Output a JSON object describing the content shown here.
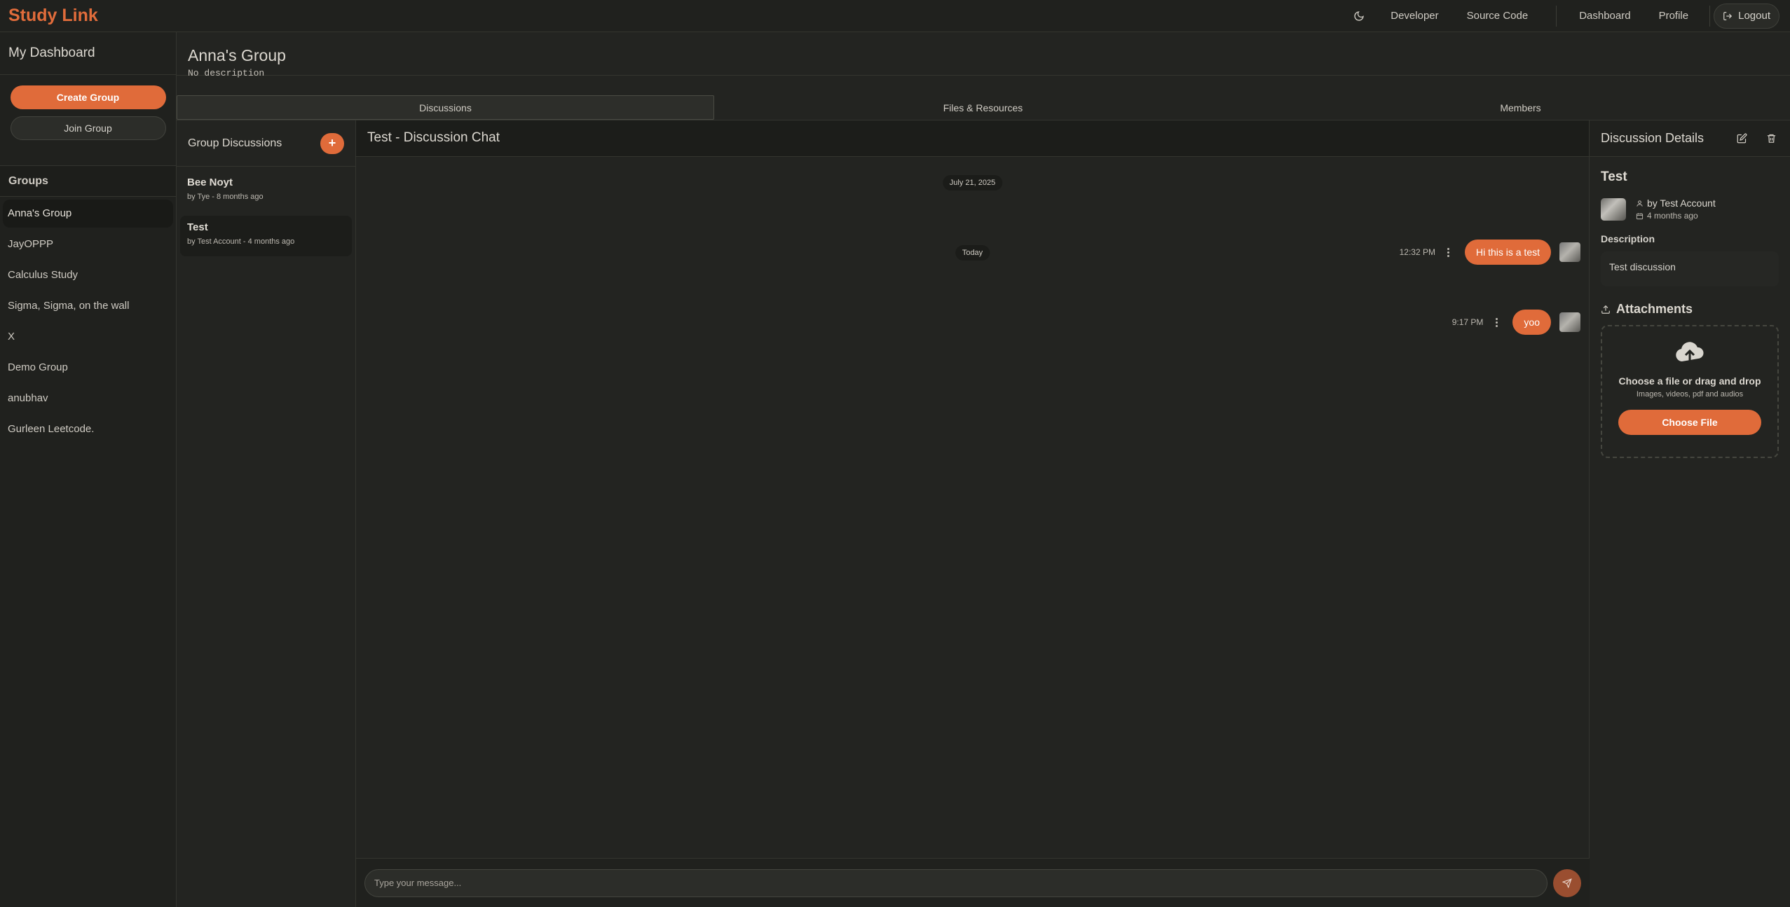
{
  "app": {
    "brand": "Study Link",
    "nav": {
      "developer": "Developer",
      "source_code": "Source Code",
      "dashboard": "Dashboard",
      "profile": "Profile",
      "logout": "Logout"
    }
  },
  "sidebar": {
    "title": "My Dashboard",
    "create_group": "Create Group",
    "join_group": "Join Group",
    "groups_heading": "Groups",
    "groups": [
      {
        "label": "Anna's Group",
        "active": true
      },
      {
        "label": "JayOPPP"
      },
      {
        "label": "Calculus Study"
      },
      {
        "label": "Sigma, Sigma, on the wall"
      },
      {
        "label": "X"
      },
      {
        "label": "Demo Group"
      },
      {
        "label": "anubhav"
      },
      {
        "label": "Gurleen Leetcode."
      }
    ]
  },
  "group": {
    "title": "Anna's Group",
    "description": "No description",
    "tabs": [
      "Discussions",
      "Files & Resources",
      "Members"
    ],
    "active_tab": "Discussions"
  },
  "discussions": {
    "heading": "Group Discussions",
    "add_label": "+",
    "items": [
      {
        "name": "Bee Noyt",
        "meta": "by Tye - 8 months ago"
      },
      {
        "name": "Test",
        "meta": "by Test Account - 4 months ago",
        "active": true
      }
    ]
  },
  "chat": {
    "title": "Test - Discussion Chat",
    "groups": [
      {
        "date": "July 21, 2025",
        "messages": [
          {
            "time": "12:32 PM",
            "text": "Hi this is a test"
          }
        ]
      },
      {
        "date": "Today",
        "messages": [
          {
            "time": "9:17 PM",
            "text": "yoo"
          }
        ]
      }
    ],
    "input_placeholder": "Type your message..."
  },
  "details": {
    "heading": "Discussion Details",
    "title": "Test",
    "author": "by Test Account",
    "time": "4 months ago",
    "description_label": "Description",
    "description": "Test discussion",
    "attachments_label": "Attachments",
    "dropzone_title": "Choose a file or drag and drop",
    "dropzone_sub": "Images, videos, pdf and audios",
    "choose_file": "Choose File"
  },
  "colors": {
    "accent": "#e06b3a",
    "background": "#232421",
    "panel": "#20211e"
  }
}
